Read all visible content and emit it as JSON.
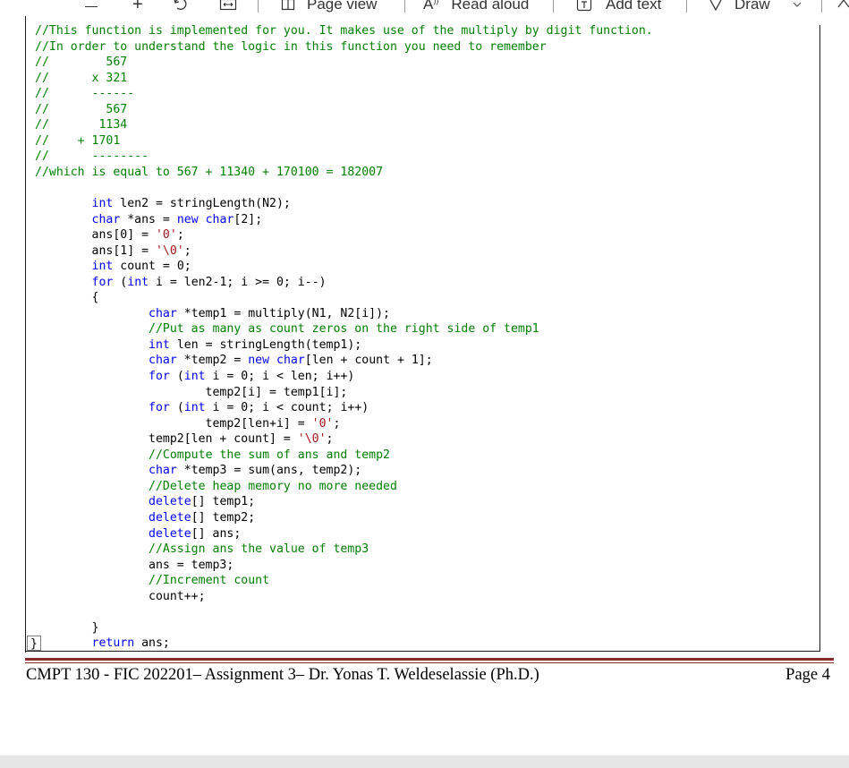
{
  "toolbar": {
    "zoom_out_icon": "minus-icon",
    "zoom_in_icon": "plus-icon",
    "rotate_icon": "rotate-icon",
    "fit_icon": "fit-width-icon",
    "page_view_label": "Page view",
    "read_aloud_label": "Read aloud",
    "add_text_label": "Add text",
    "draw_label": "Draw"
  },
  "code": {
    "lines": [
      [
        [
          "c",
          "//This function is implemented for you. It makes use of the multiply by digit function."
        ]
      ],
      [
        [
          "c",
          "//In order to understand the logic in this function you need to remember"
        ]
      ],
      [
        [
          "c",
          "//"
        ],
        [
          "",
          "        "
        ],
        [
          "c",
          "567"
        ]
      ],
      [
        [
          "c",
          "//"
        ],
        [
          "",
          "      "
        ],
        [
          "c",
          "x 321"
        ]
      ],
      [
        [
          "c",
          "//"
        ],
        [
          "",
          "      "
        ],
        [
          "c",
          "------"
        ]
      ],
      [
        [
          "c",
          "//"
        ],
        [
          "",
          "        "
        ],
        [
          "c",
          "567"
        ]
      ],
      [
        [
          "c",
          "//"
        ],
        [
          "",
          "       "
        ],
        [
          "c",
          "1134"
        ]
      ],
      [
        [
          "c",
          "//"
        ],
        [
          "",
          "    "
        ],
        [
          "c",
          "+ 1701"
        ]
      ],
      [
        [
          "c",
          "//"
        ],
        [
          "",
          "      "
        ],
        [
          "c",
          "--------"
        ]
      ],
      [
        [
          "c",
          "//which is equal to 567 + 11340 + 170100 = 182007"
        ]
      ],
      [],
      [
        [
          "",
          "        "
        ],
        [
          "k",
          "int"
        ],
        [
          "",
          " len2 = stringLength(N2);"
        ]
      ],
      [
        [
          "",
          "        "
        ],
        [
          "k",
          "char"
        ],
        [
          "",
          " *ans = "
        ],
        [
          "k",
          "new"
        ],
        [
          "",
          " "
        ],
        [
          "k",
          "char"
        ],
        [
          "",
          "[2];"
        ]
      ],
      [
        [
          "",
          "        ans[0] = "
        ],
        [
          "s",
          "'0'"
        ],
        [
          "",
          ";"
        ]
      ],
      [
        [
          "",
          "        ans[1] = "
        ],
        [
          "s",
          "'\\0'"
        ],
        [
          "",
          ";"
        ]
      ],
      [
        [
          "",
          "        "
        ],
        [
          "k",
          "int"
        ],
        [
          "",
          " count = 0;"
        ]
      ],
      [
        [
          "",
          "        "
        ],
        [
          "k",
          "for"
        ],
        [
          "",
          " ("
        ],
        [
          "k",
          "int"
        ],
        [
          "",
          " i = len2-1; i >= 0; i--)"
        ]
      ],
      [
        [
          "",
          "        {"
        ]
      ],
      [
        [
          "",
          "                "
        ],
        [
          "k",
          "char"
        ],
        [
          "",
          " *temp1 = multiply(N1, N2[i]);"
        ]
      ],
      [
        [
          "",
          "                "
        ],
        [
          "c",
          "//Put as many as count zeros on the right side of temp1"
        ]
      ],
      [
        [
          "",
          "                "
        ],
        [
          "k",
          "int"
        ],
        [
          "",
          " len = stringLength(temp1);"
        ]
      ],
      [
        [
          "",
          "                "
        ],
        [
          "k",
          "char"
        ],
        [
          "",
          " *temp2 = "
        ],
        [
          "k",
          "new"
        ],
        [
          "",
          " "
        ],
        [
          "k",
          "char"
        ],
        [
          "",
          "[len + count + 1];"
        ]
      ],
      [
        [
          "",
          "                "
        ],
        [
          "k",
          "for"
        ],
        [
          "",
          " ("
        ],
        [
          "k",
          "int"
        ],
        [
          "",
          " i = 0; i < len; i++)"
        ]
      ],
      [
        [
          "",
          "                        temp2[i] = temp1[i];"
        ]
      ],
      [
        [
          "",
          "                "
        ],
        [
          "k",
          "for"
        ],
        [
          "",
          " ("
        ],
        [
          "k",
          "int"
        ],
        [
          "",
          " i = 0; i < count; i++)"
        ]
      ],
      [
        [
          "",
          "                        temp2[len+i] = "
        ],
        [
          "s",
          "'0'"
        ],
        [
          "",
          ";"
        ]
      ],
      [
        [
          "",
          "                temp2[len + count] = "
        ],
        [
          "s",
          "'\\0'"
        ],
        [
          "",
          ";"
        ]
      ],
      [
        [
          "",
          "                "
        ],
        [
          "c",
          "//Compute the sum of ans and temp2"
        ]
      ],
      [
        [
          "",
          "                "
        ],
        [
          "k",
          "char"
        ],
        [
          "",
          " *temp3 = sum(ans, temp2);"
        ]
      ],
      [
        [
          "",
          "                "
        ],
        [
          "c",
          "//Delete heap memory no more needed"
        ]
      ],
      [
        [
          "",
          "                "
        ],
        [
          "k",
          "delete"
        ],
        [
          "",
          "[] temp1;"
        ]
      ],
      [
        [
          "",
          "                "
        ],
        [
          "k",
          "delete"
        ],
        [
          "",
          "[] temp2;"
        ]
      ],
      [
        [
          "",
          "                "
        ],
        [
          "k",
          "delete"
        ],
        [
          "",
          "[] ans;"
        ]
      ],
      [
        [
          "",
          "                "
        ],
        [
          "c",
          "//Assign ans the value of temp3"
        ]
      ],
      [
        [
          "",
          "                ans = temp3;"
        ]
      ],
      [
        [
          "",
          "                "
        ],
        [
          "c",
          "//Increment count"
        ]
      ],
      [
        [
          "",
          "                count++;"
        ]
      ],
      [],
      [
        [
          "",
          "        }"
        ]
      ],
      [
        [
          "",
          "        "
        ],
        [
          "k",
          "return"
        ],
        [
          "",
          " ans;"
        ]
      ]
    ],
    "closing_brace": "}"
  },
  "footer": {
    "left_text": "CMPT 130 - FIC 202201– Assignment 3– Dr. Yonas T. Weldeselassie (Ph.D.)",
    "page_label": "Page 4"
  },
  "colors": {
    "comment": "#008000",
    "keyword": "#0000ff",
    "string": "#a31515",
    "rule": "#8b2b28"
  }
}
